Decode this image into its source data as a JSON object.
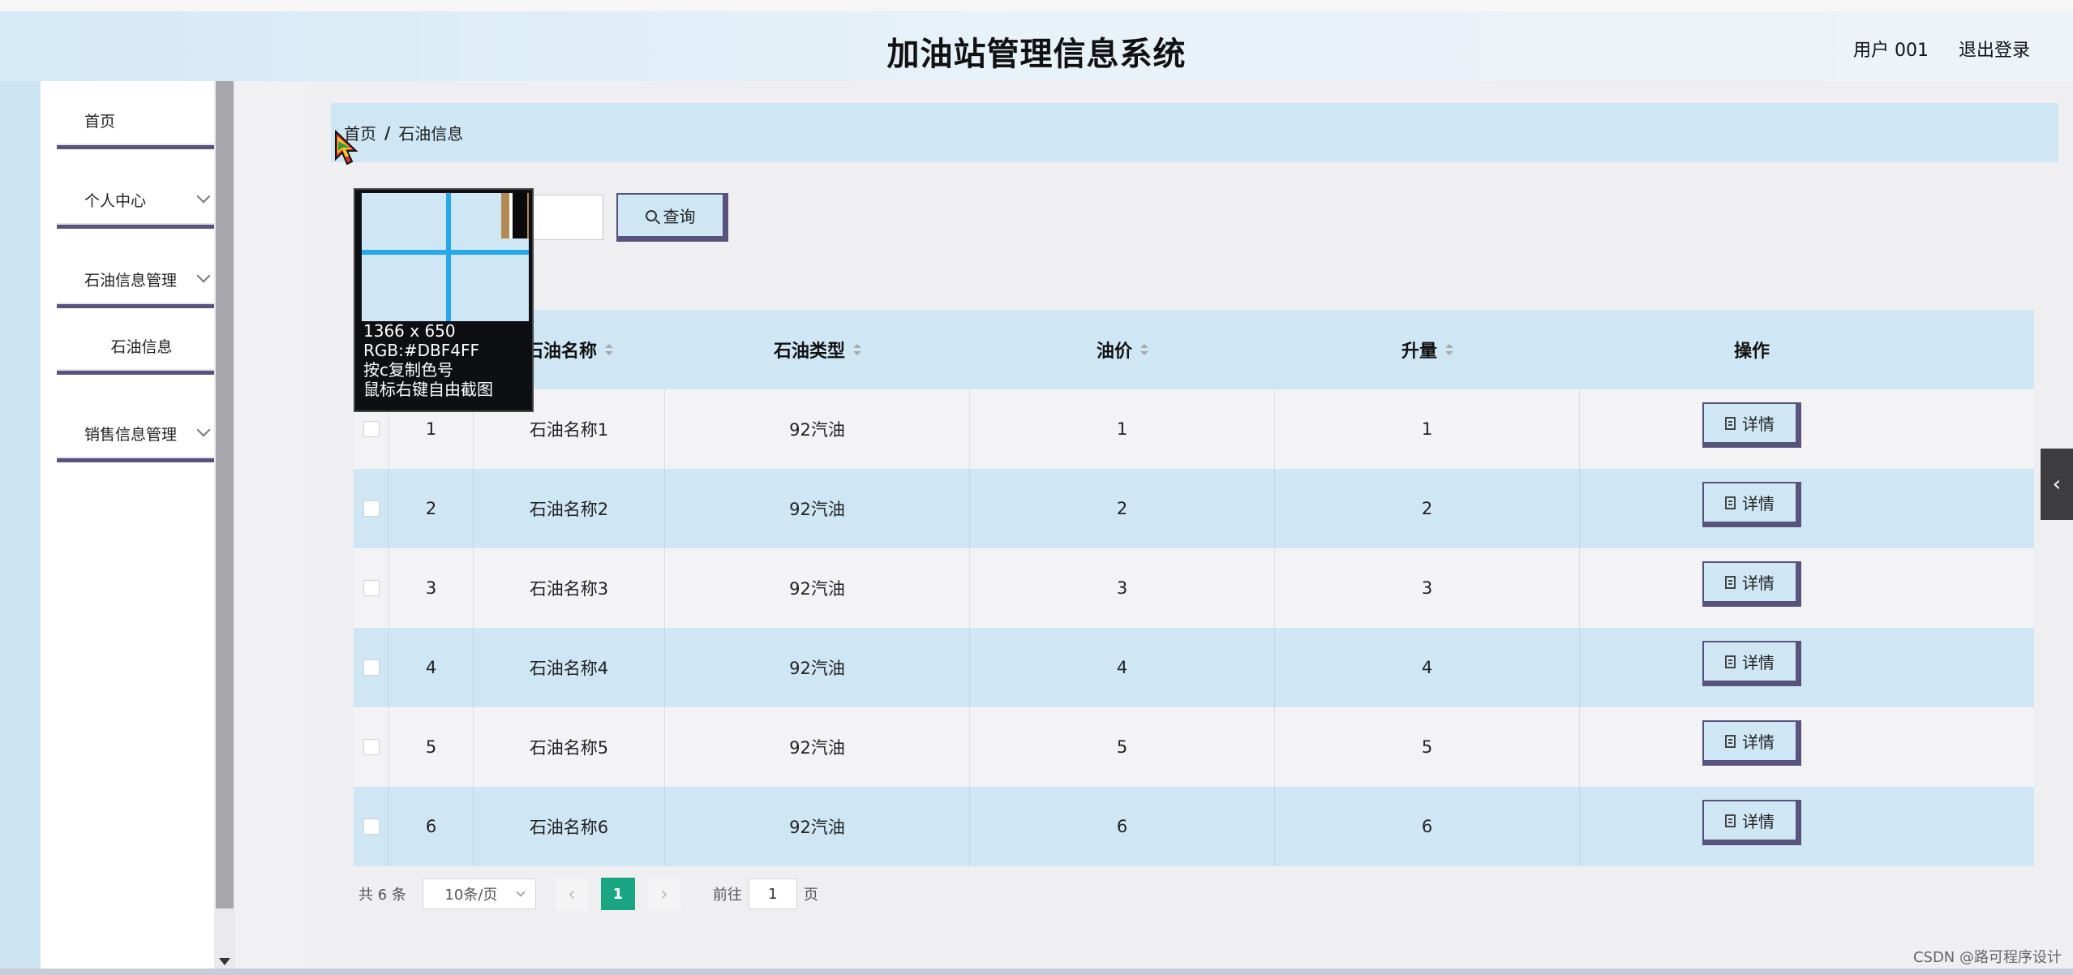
{
  "app": {
    "title": "加油站管理信息系统",
    "user": "用户 001",
    "logout": "退出登录"
  },
  "sidebar": {
    "items": [
      {
        "label": "首页"
      },
      {
        "label": "个人中心"
      },
      {
        "label": "石油信息管理"
      },
      {
        "label": "石油信息"
      },
      {
        "label": "销售信息管理"
      }
    ]
  },
  "breadcrumb": {
    "home": "首页",
    "sep": "/",
    "current": "石油信息"
  },
  "search": {
    "button": "查询",
    "value": ""
  },
  "table": {
    "headers": [
      "石油名称",
      "石油类型",
      "油价",
      "升量",
      "操作"
    ],
    "action_label": "详情",
    "rows": [
      {
        "index": "1",
        "name": "石油名称1",
        "type": "92汽油",
        "price": "1",
        "volume": "1"
      },
      {
        "index": "2",
        "name": "石油名称2",
        "type": "92汽油",
        "price": "2",
        "volume": "2"
      },
      {
        "index": "3",
        "name": "石油名称3",
        "type": "92汽油",
        "price": "3",
        "volume": "3"
      },
      {
        "index": "4",
        "name": "石油名称4",
        "type": "92汽油",
        "price": "4",
        "volume": "4"
      },
      {
        "index": "5",
        "name": "石油名称5",
        "type": "92汽油",
        "price": "5",
        "volume": "5"
      },
      {
        "index": "6",
        "name": "石油名称6",
        "type": "92汽油",
        "price": "6",
        "volume": "6"
      }
    ]
  },
  "pagination": {
    "total": "共 6 条",
    "page_size": "10条/页",
    "current_page": "1",
    "goto_label": "前往",
    "goto_value": "1",
    "page_unit": "页"
  },
  "color_picker": {
    "size": "1366 x 650",
    "rgb": "RGB:#DBF4FF",
    "copy_hint": "按c复制色号",
    "capture_hint": "鼠标右键自由截图"
  },
  "watermark": "CSDN @路可程序设计",
  "colors": {
    "header_bg": "#d5e9f6",
    "row_highlight": "#cfe6f4",
    "button_border": "#57537d",
    "pager_active": "#1aa682"
  }
}
